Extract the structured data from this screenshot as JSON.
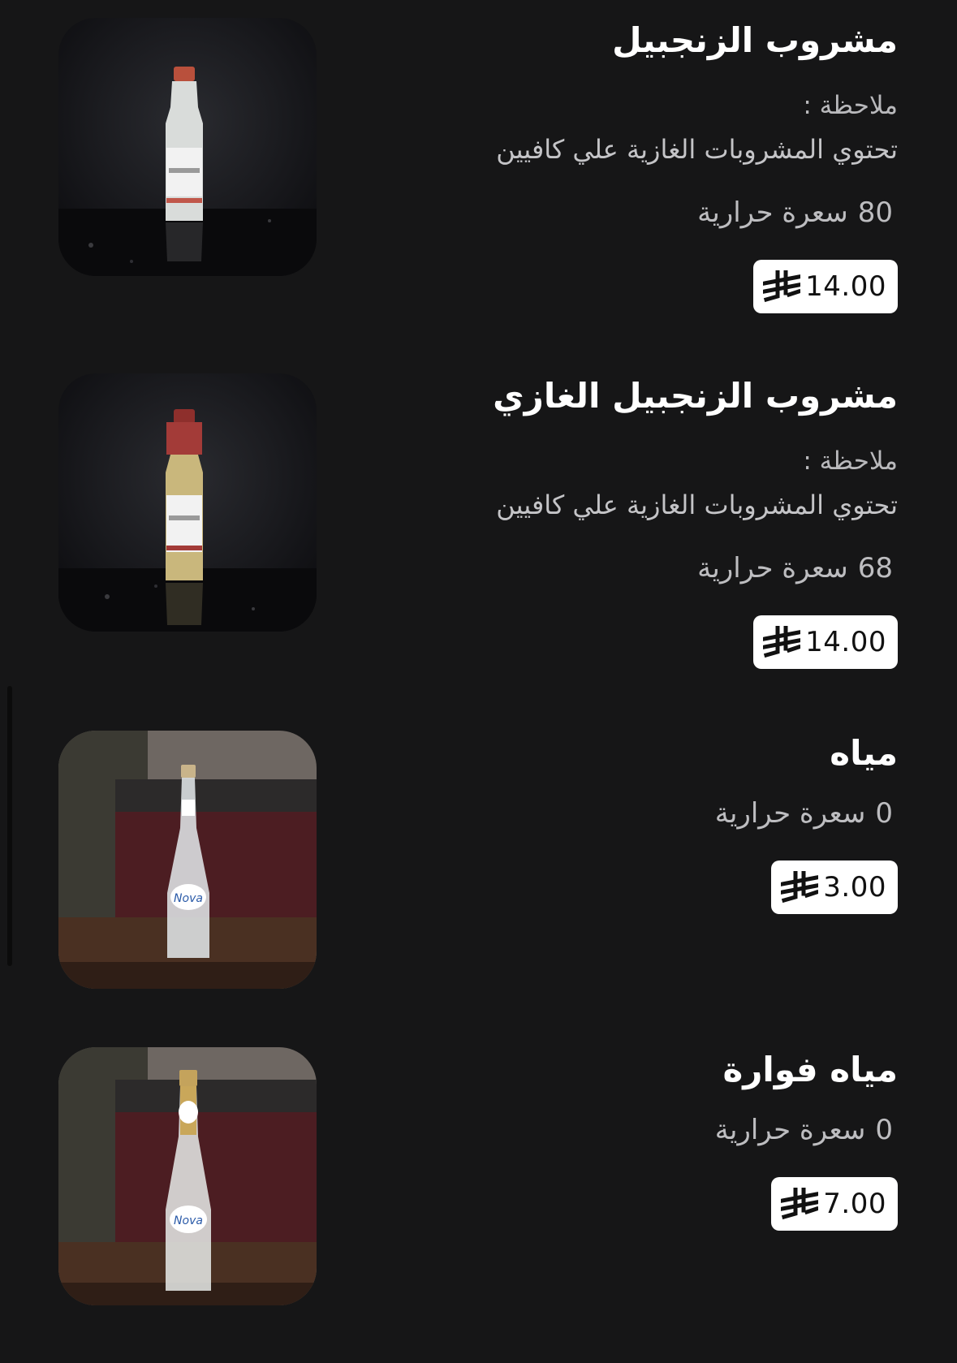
{
  "currency_icon": "saudi-riyal-icon",
  "colors": {
    "background": "#161617",
    "title": "#ffffff",
    "secondary_text": "#bdbdc0",
    "price_badge_bg": "#ffffff",
    "price_badge_text": "#111111"
  },
  "items": [
    {
      "title": "مشروب الزنجبيل",
      "note_label": "ملاحظة :",
      "note_text": "تحتوي المشروبات الغازية علي كافيين",
      "calories_value": "80",
      "calories_unit": "سعرة حرارية",
      "price": "14.00",
      "image": "ginger-drink-bottle-photo"
    },
    {
      "title": "مشروب الزنجبيل الغازي",
      "note_label": "ملاحظة :",
      "note_text": "تحتوي المشروبات الغازية علي كافيين",
      "calories_value": "68",
      "calories_unit": "سعرة حرارية",
      "price": "14.00",
      "image": "sparkling-ginger-drink-bottle-photo"
    },
    {
      "title": "مياه",
      "calories_value": "0",
      "calories_unit": "سعرة حرارية",
      "price": "3.00",
      "image": "water-bottle-photo"
    },
    {
      "title": "مياه فوارة",
      "calories_value": "0",
      "calories_unit": "سعرة حرارية",
      "price": "7.00",
      "image": "sparkling-water-bottle-photo"
    }
  ]
}
